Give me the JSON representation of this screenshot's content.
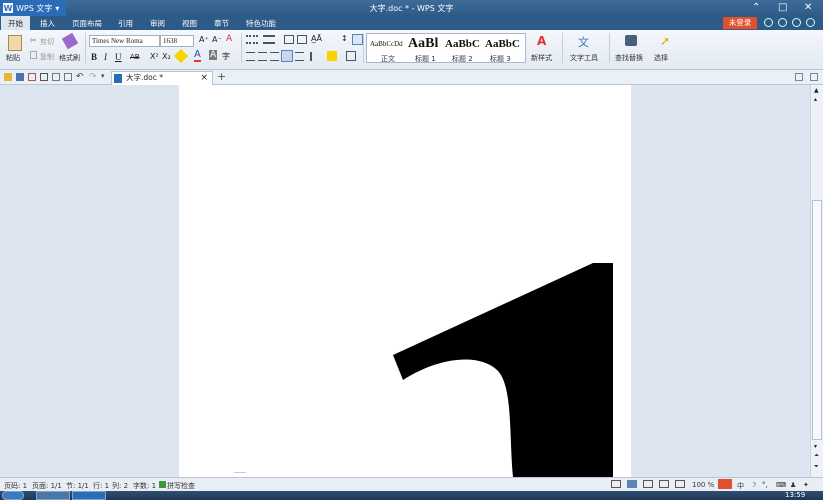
{
  "titlebar": {
    "app_name": "WPS 文字",
    "doc_title": "大字.doc * - WPS 文字",
    "min": "⌃",
    "restore": "□",
    "close": "✕"
  },
  "menubar": {
    "items": [
      "开始",
      "插入",
      "页面布局",
      "引用",
      "审阅",
      "视图",
      "章节",
      "特色功能"
    ],
    "login": "未登录"
  },
  "ribbon": {
    "paste": "粘贴",
    "cut": "剪切",
    "copy": "复制",
    "format_painter": "格式刷",
    "font_name": "Times New Roma",
    "font_size": "1638",
    "bold": "B",
    "italic": "I",
    "underline": "U",
    "strikethrough": "AB",
    "superscript": "X²",
    "subscript": "X₂",
    "font_color_glyph": "A",
    "highlight_glyph": "A",
    "styles": [
      {
        "preview": "AaBbCcDd",
        "label": "正文"
      },
      {
        "preview": "AaBl",
        "label": "标题 1"
      },
      {
        "preview": "AaBbC",
        "label": "标题 2"
      },
      {
        "preview": "AaBbC",
        "label": "标题 3"
      }
    ],
    "new_style": "新样式",
    "text_tools": "文字工具",
    "find_replace": "查找替换",
    "select": "选择"
  },
  "tabs": {
    "doc_tab": "大字.doc *",
    "close": "×",
    "add": "+"
  },
  "statusbar": {
    "page_code": "页码: 1",
    "page": "页面: 1/1",
    "section": "节: 1/1",
    "row": "行: 1",
    "col": "列: 2",
    "word_count": "字数: 1",
    "spell_check": "拼写检查",
    "zoom": "100 %"
  },
  "taskbar": {
    "clock": "13:59"
  },
  "colors": {
    "title_bg": "#2e5a88",
    "accent": "#2b6cb8",
    "login_bg": "#e2502f",
    "page": "#ffffff",
    "glyph": "#000000"
  }
}
